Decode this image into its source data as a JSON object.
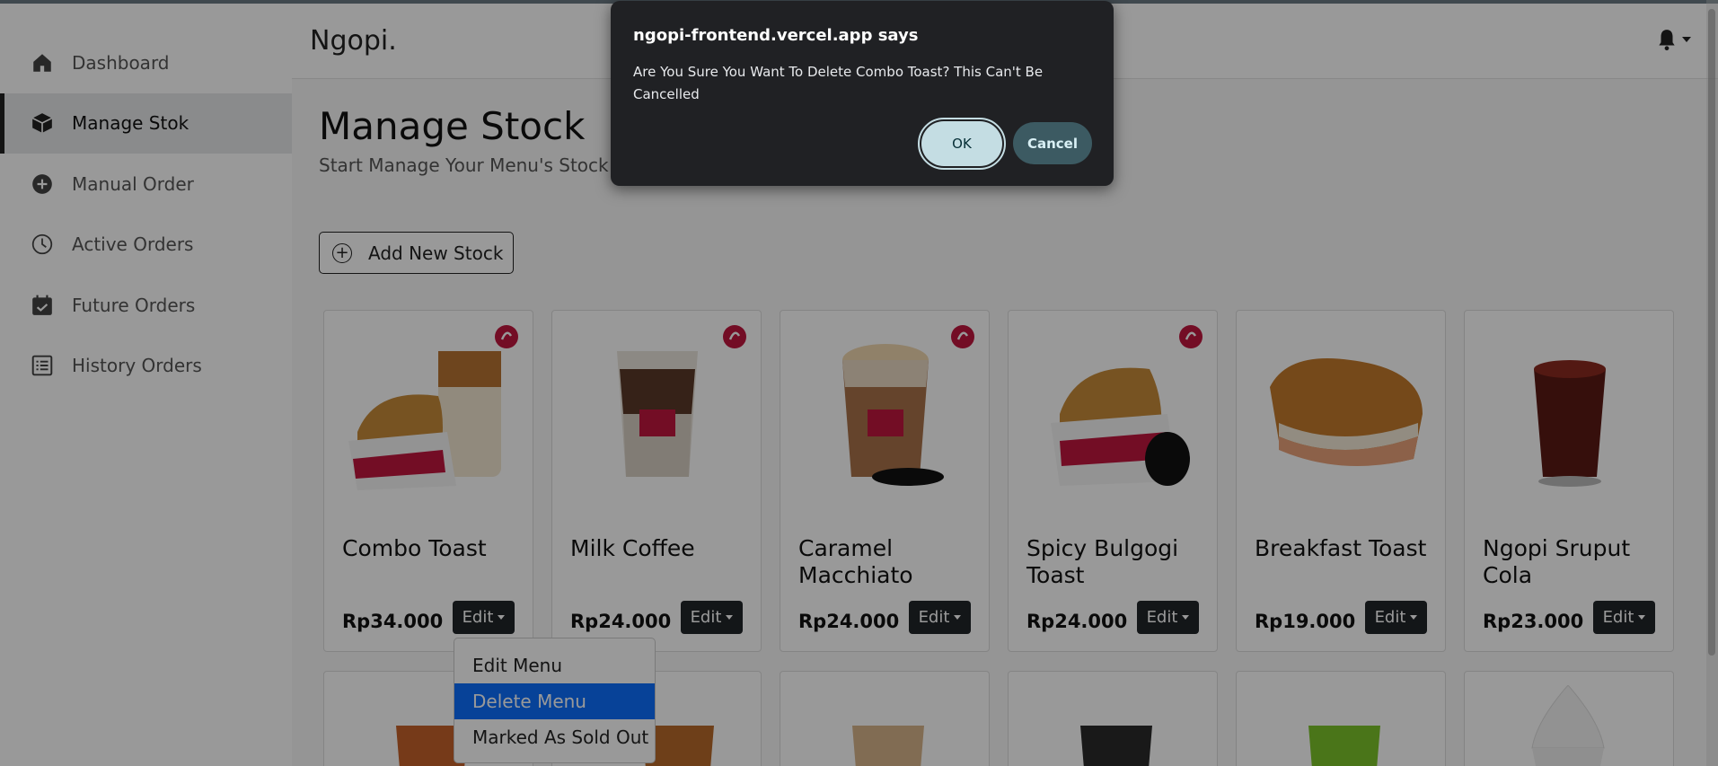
{
  "sidebar": {
    "items": [
      {
        "label": "Dashboard",
        "icon": "home-icon",
        "active": false
      },
      {
        "label": "Manage Stok",
        "icon": "box-icon",
        "active": true
      },
      {
        "label": "Manual Order",
        "icon": "plus-circle-icon",
        "active": false
      },
      {
        "label": "Active Orders",
        "icon": "clock-icon",
        "active": false
      },
      {
        "label": "Future Orders",
        "icon": "calendar-check-icon",
        "active": false
      },
      {
        "label": "History Orders",
        "icon": "list-icon",
        "active": false
      }
    ]
  },
  "header": {
    "brand": "Ngopi.",
    "notification_icon": "bell-icon"
  },
  "main": {
    "title": "Manage Stock",
    "subtitle": "Start Manage Your Menu's Stock",
    "add_button": "Add New Stock"
  },
  "products": [
    {
      "name": "Combo Toast",
      "price": "Rp34.000",
      "edit": "Edit"
    },
    {
      "name": "Milk Coffee",
      "price": "Rp24.000",
      "edit": "Edit"
    },
    {
      "name": "Caramel Macchiato",
      "price": "Rp24.000",
      "edit": "Edit"
    },
    {
      "name": "Spicy Bulgogi Toast",
      "price": "Rp24.000",
      "edit": "Edit"
    },
    {
      "name": "Breakfast Toast",
      "price": "Rp19.000",
      "edit": "Edit"
    },
    {
      "name": "Ngopi Sruput Cola",
      "price": "Rp23.000",
      "edit": "Edit"
    }
  ],
  "dropdown": {
    "items": [
      "Edit Menu",
      "Delete Menu",
      "Marked As Sold Out"
    ],
    "selected": "Delete Menu"
  },
  "dialog": {
    "title": "ngopi-frontend.vercel.app says",
    "message": "Are You Sure You Want To Delete Combo Toast? This Can't Be Cancelled",
    "ok": "OK",
    "cancel": "Cancel"
  },
  "colors": {
    "accent": "#0d6efd",
    "dark": "#212529",
    "dialog_bg": "#202124",
    "ok_bg": "#c4dde3",
    "cancel_bg": "#3c5a62"
  }
}
